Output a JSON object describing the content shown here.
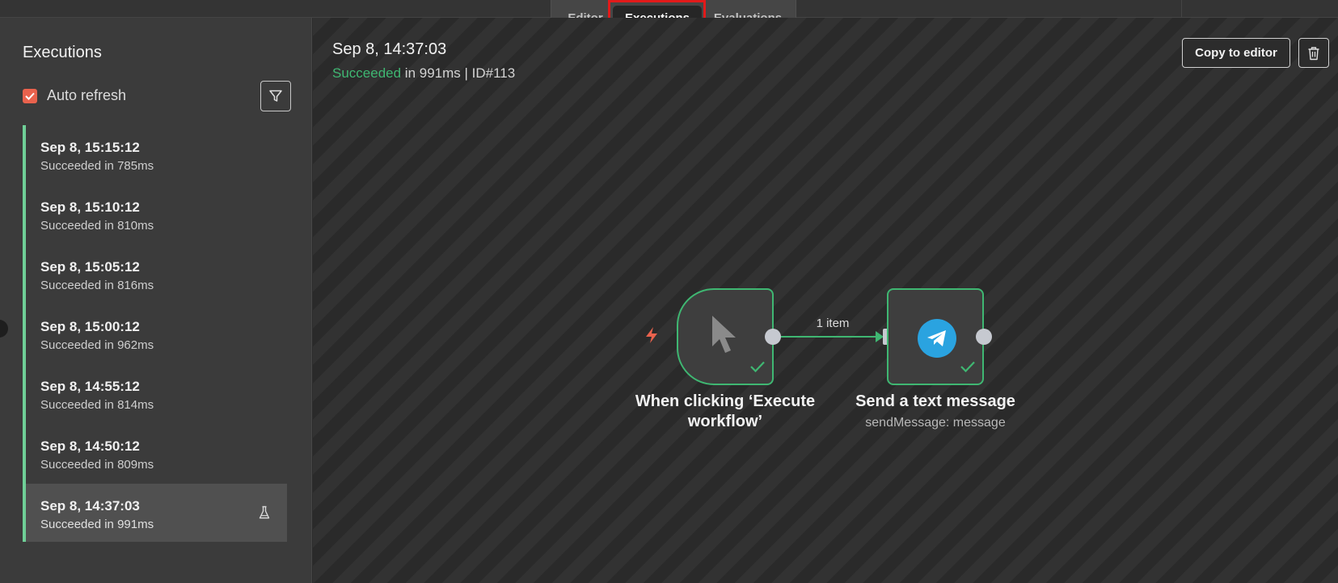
{
  "tabs": {
    "editor": "Editor",
    "executions": "Executions",
    "evaluations": "Evaluations"
  },
  "sidebar": {
    "title": "Executions",
    "auto_refresh_label": "Auto refresh",
    "auto_refresh_checked": true,
    "items": [
      {
        "date": "Sep 8, 15:15:12",
        "status": "Succeeded in 785ms"
      },
      {
        "date": "Sep 8, 15:10:12",
        "status": "Succeeded in 810ms"
      },
      {
        "date": "Sep 8, 15:05:12",
        "status": "Succeeded in 816ms"
      },
      {
        "date": "Sep 8, 15:00:12",
        "status": "Succeeded in 962ms"
      },
      {
        "date": "Sep 8, 14:55:12",
        "status": "Succeeded in 814ms"
      },
      {
        "date": "Sep 8, 14:50:12",
        "status": "Succeeded in 809ms"
      },
      {
        "date": "Sep 8, 14:37:03",
        "status": "Succeeded in 991ms",
        "selected": true,
        "icon": "flask-icon"
      }
    ]
  },
  "execution": {
    "title": "Sep 8, 14:37:03",
    "status_word": "Succeeded",
    "status_rest": " in 991ms | ID#113"
  },
  "actions": {
    "copy_to_editor": "Copy to editor",
    "delete_icon": "trash-icon"
  },
  "workflow": {
    "connection_label": "1 item",
    "nodes": [
      {
        "name": "When clicking ‘Execute workflow’",
        "icon": "cursor-icon",
        "status": "success"
      },
      {
        "name": "Send a text message",
        "subtitle": "sendMessage: message",
        "icon": "telegram-icon",
        "status": "success"
      }
    ]
  },
  "colors": {
    "success": "#3fb772",
    "accent": "#e9624d",
    "annotation": "#e21a1a",
    "telegram": "#2aa3e0"
  }
}
